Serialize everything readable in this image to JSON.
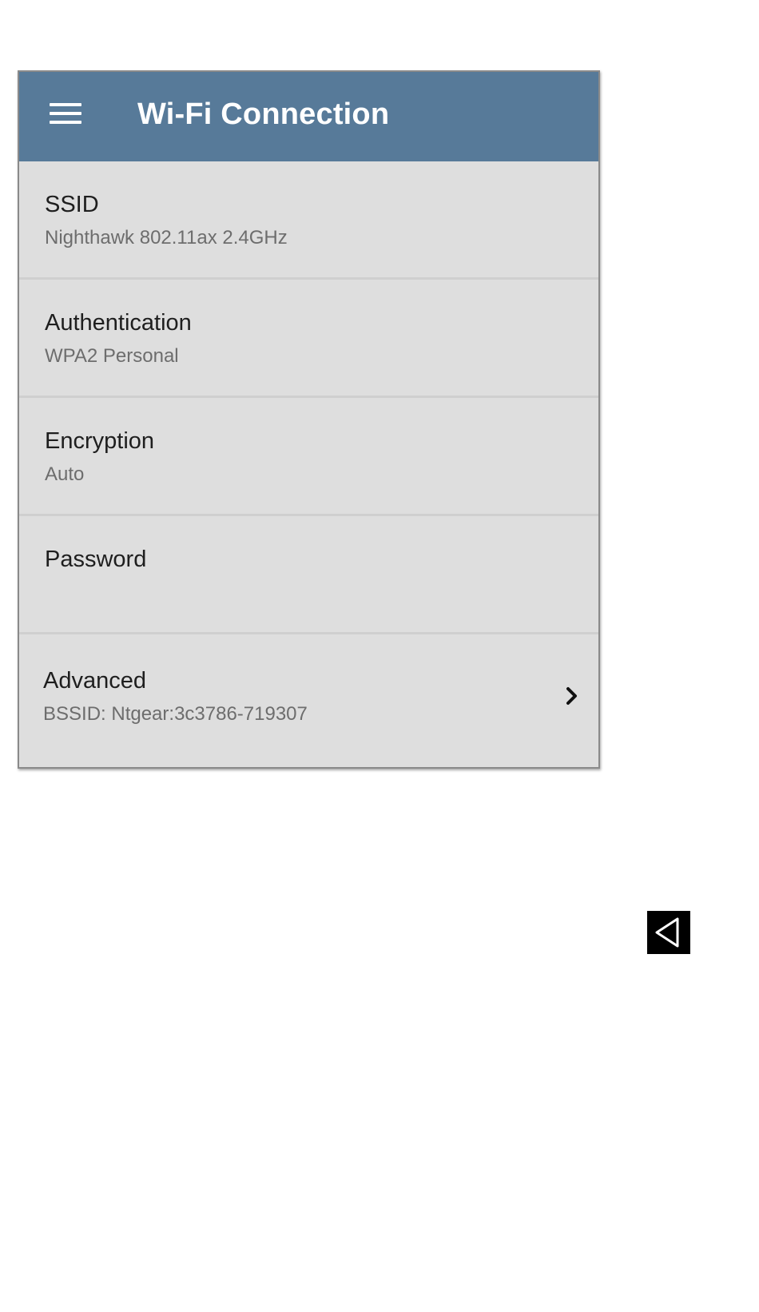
{
  "app_bar": {
    "title": "Wi-Fi Connection",
    "menu_icon": "hamburger-menu-icon",
    "background_color": "#577a99"
  },
  "settings": [
    {
      "label": "SSID",
      "value": "Nighthawk 802.11ax 2.4GHz"
    },
    {
      "label": "Authentication",
      "value": "WPA2 Personal"
    },
    {
      "label": "Encryption",
      "value": "Auto"
    },
    {
      "label": "Password",
      "value": ""
    },
    {
      "label": "Advanced",
      "value": "BSSID:  Ntgear:3c3786-719307",
      "icon": "chevron-right-icon"
    }
  ],
  "navigation": {
    "back_icon": "triangle-back-icon"
  }
}
